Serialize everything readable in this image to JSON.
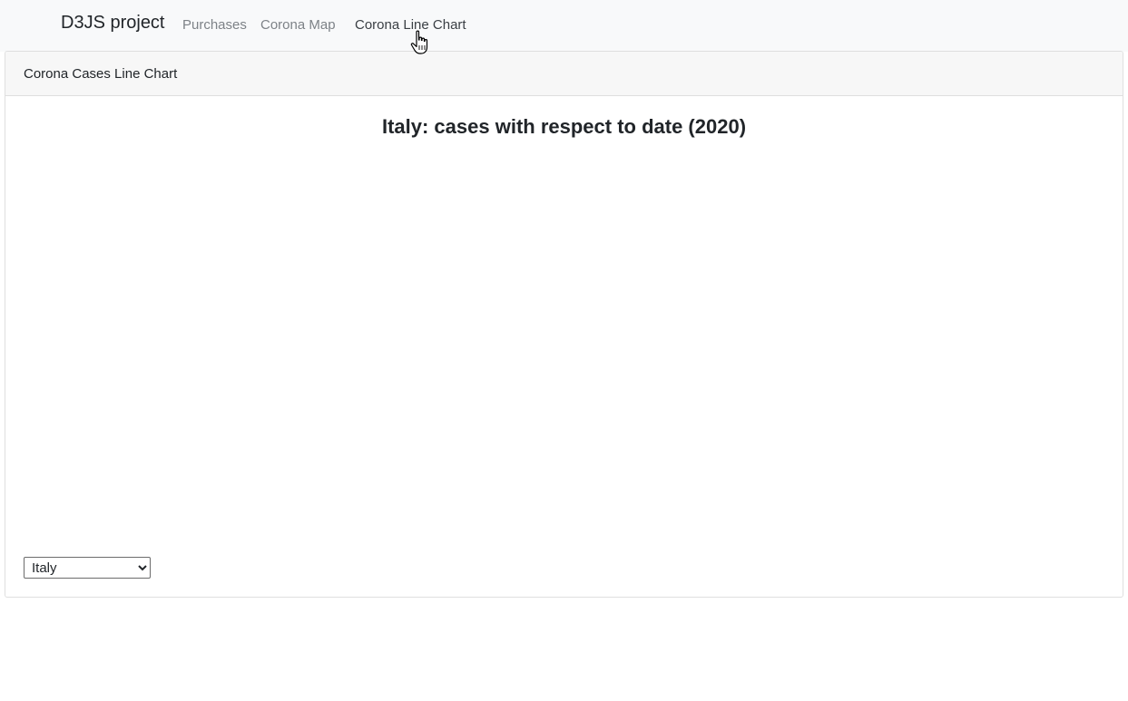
{
  "navbar": {
    "brand": "D3JS project",
    "links": [
      {
        "label": "Purchases",
        "active": false
      },
      {
        "label": "Corona Map",
        "active": false
      },
      {
        "label": "Corona Line Chart",
        "active": true
      }
    ]
  },
  "card": {
    "header": "Corona Cases Line Chart",
    "chart_title": "Italy: cases with respect to date (2020)"
  },
  "country_select": {
    "selected": "Italy",
    "options": [
      "Italy"
    ]
  },
  "cursor": {
    "icon": "hand-pointer-icon"
  }
}
